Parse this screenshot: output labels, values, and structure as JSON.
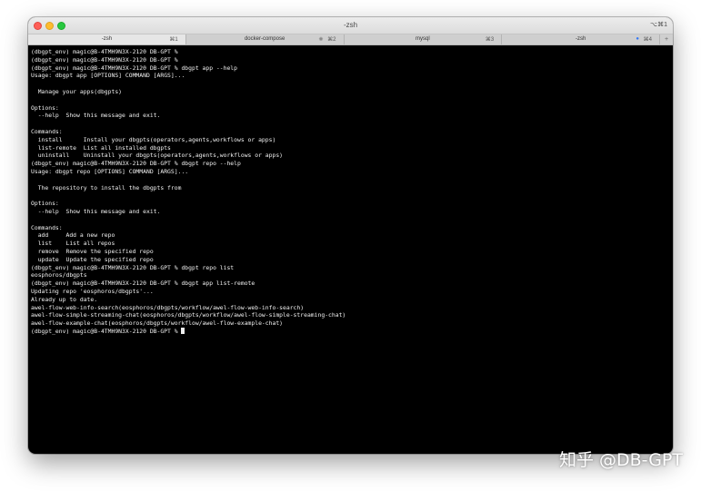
{
  "window": {
    "title": "-zsh",
    "shortcut": "⌥⌘1"
  },
  "tabs": [
    {
      "label": "-zsh",
      "shortcut": "⌘1",
      "active": true,
      "indicator": ""
    },
    {
      "label": "docker-compose",
      "shortcut": "⌘2",
      "active": false,
      "indicator": "spinner"
    },
    {
      "label": "mysql",
      "shortcut": "⌘3",
      "active": false,
      "indicator": ""
    },
    {
      "label": "-zsh",
      "shortcut": "⌘4",
      "active": false,
      "indicator": "dot"
    }
  ],
  "new_tab": "+",
  "terminal": {
    "lines": [
      "(dbgpt_env) magic@B-4TMH9N3X-2120 DB-GPT % ",
      "(dbgpt_env) magic@B-4TMH9N3X-2120 DB-GPT % ",
      "(dbgpt_env) magic@B-4TMH9N3X-2120 DB-GPT % dbgpt app --help",
      "Usage: dbgpt app [OPTIONS] COMMAND [ARGS]...",
      "",
      "  Manage your apps(dbgpts)",
      "",
      "Options:",
      "  --help  Show this message and exit.",
      "",
      "Commands:",
      "  install      Install your dbgpts(operators,agents,workflows or apps)",
      "  list-remote  List all installed dbgpts",
      "  uninstall    Uninstall your dbgpts(operators,agents,workflows or apps)",
      "(dbgpt_env) magic@B-4TMH9N3X-2120 DB-GPT % dbgpt repo --help",
      "Usage: dbgpt repo [OPTIONS] COMMAND [ARGS]...",
      "",
      "  The repository to install the dbgpts from",
      "",
      "Options:",
      "  --help  Show this message and exit.",
      "",
      "Commands:",
      "  add     Add a new repo",
      "  list    List all repos",
      "  remove  Remove the specified repo",
      "  update  Update the specified repo",
      "(dbgpt_env) magic@B-4TMH9N3X-2120 DB-GPT % dbgpt repo list",
      "eosphoros/dbgpts",
      "(dbgpt_env) magic@B-4TMH9N3X-2120 DB-GPT % dbgpt app list-remote",
      "Updating repo 'eosphoros/dbgpts'...",
      "Already up to date.",
      "awel-flow-web-info-search(eosphoros/dbgpts/workflow/awel-flow-web-info-search)",
      "awel-flow-simple-streaming-chat(eosphoros/dbgpts/workflow/awel-flow-simple-streaming-chat)",
      "awel-flow-example-chat(eosphoros/dbgpts/workflow/awel-flow-example-chat)"
    ],
    "prompt": "(dbgpt_env) magic@B-4TMH9N3X-2120 DB-GPT % "
  },
  "watermark": "知乎 @DB-GPT"
}
